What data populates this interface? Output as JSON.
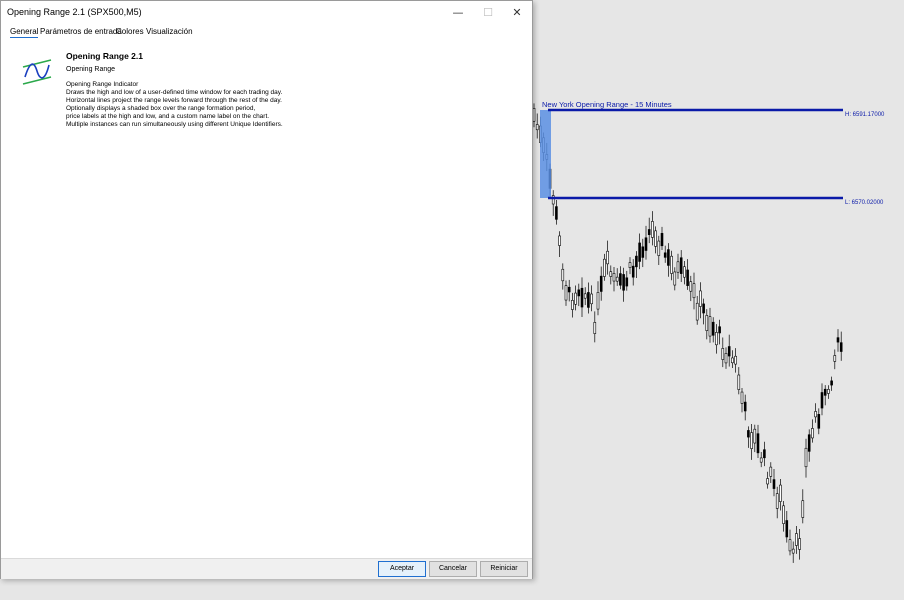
{
  "dialog": {
    "title": "Opening Range 2.1 (SPX500,M5)",
    "window_buttons": {
      "minimize": "—",
      "maximize": "☐",
      "close": "✕"
    },
    "tabs": [
      {
        "label": "General",
        "active": true
      },
      {
        "label": "Parámetros de entrada",
        "active": false
      },
      {
        "label": "Colores",
        "active": false
      },
      {
        "label": "Visualización",
        "active": false
      }
    ],
    "indicator": {
      "icon": "indicator-icon",
      "name": "Opening Range 2.1",
      "subtitle": "Opening Range",
      "description": [
        "Opening Range Indicator",
        "Draws the high and low of a user-defined time window for each trading day.",
        "Horizontal lines project the range levels forward through the rest of the day.",
        "Optionally displays a shaded box over the range formation period,",
        "price labels at the high and low, and a custom name label on the chart.",
        "Multiple instances can run simultaneously using different Unique Identifiers."
      ]
    },
    "buttons": {
      "ok": "Aceptar",
      "cancel": "Cancelar",
      "reset": "Reiniciar"
    }
  },
  "chart": {
    "range_label": "New York Opening Range - 15 Minutes",
    "high_label": "H: 6591.17000",
    "low_label": "L: 6570.02000",
    "colors": {
      "range_line": "#0a1aa8",
      "range_box": "#5b8fe3",
      "background": "#e6e6e6",
      "candles": "#000000"
    }
  }
}
